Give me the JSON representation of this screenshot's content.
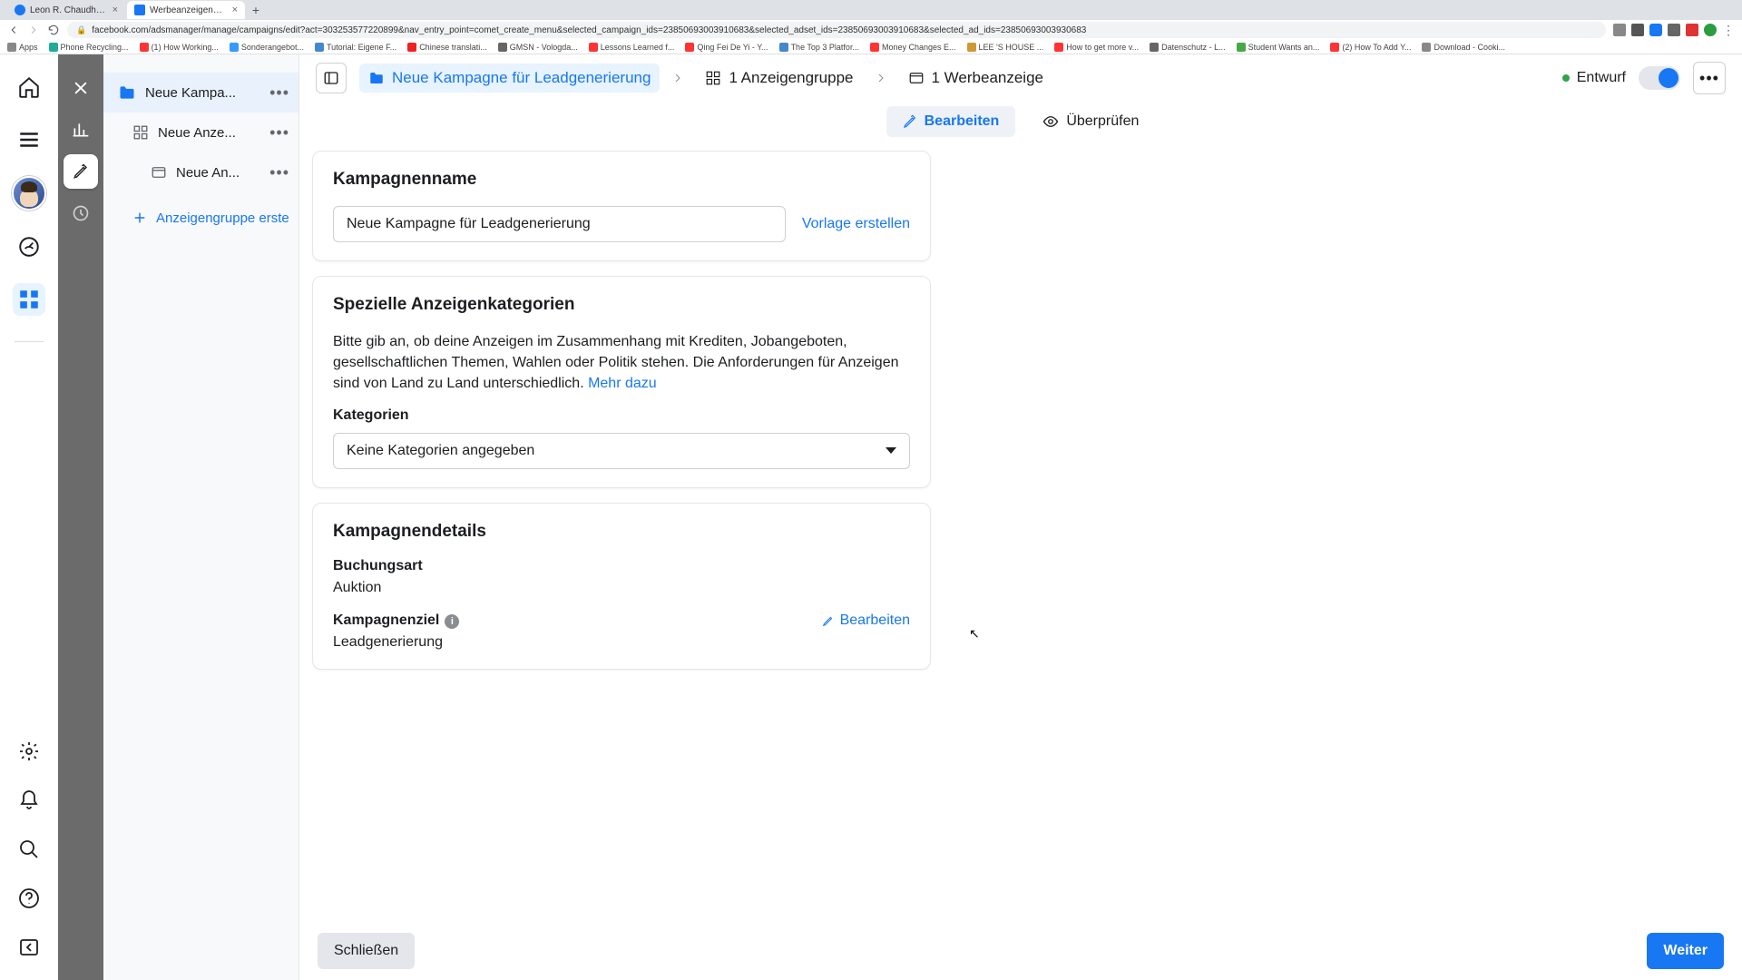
{
  "browser": {
    "tabs": [
      {
        "title": "Leon R. Chaudhari | Facebook"
      },
      {
        "title": "Werbeanzeigenmanager - We"
      }
    ],
    "url": "facebook.com/adsmanager/manage/campaigns/edit?act=303253577220899&nav_entry_point=comet_create_menu&selected_campaign_ids=23850693003910683&selected_adset_ids=23850693003910683&selected_ad_ids=23850693003930683",
    "bookmarks": [
      "Apps",
      "Phone Recycling...",
      "(1) How Working...",
      "Sonderangebot...",
      "Tutorial: Eigene F...",
      "Chinese translati...",
      "GMSN - Vologda...",
      "Lessons Learned f...",
      "Qing Fei De Yi - Y...",
      "The Top 3 Platfor...",
      "Money Changes E...",
      "LEE 'S HOUSE ...",
      "How to get more v...",
      "Datenschutz - L...",
      "Student Wants an...",
      "(2) How To Add Y...",
      "Download - Cooki..."
    ]
  },
  "tree": {
    "campaign": "Neue Kampa...",
    "adset": "Neue Anze...",
    "ad": "Neue An...",
    "add": "Anzeigengruppe erste"
  },
  "crumbs": {
    "campaign": "Neue Kampagne für Leadgenerierung",
    "adset": "1 Anzeigengruppe",
    "ad": "1 Werbeanzeige",
    "status": "Entwurf"
  },
  "subtabs": {
    "edit": "Bearbeiten",
    "review": "Überprüfen"
  },
  "section_name": {
    "title": "Kampagnenname",
    "value": "Neue Kampagne für Leadgenerierung",
    "template_link": "Vorlage erstellen"
  },
  "section_categories": {
    "title": "Spezielle Anzeigenkategorien",
    "desc": "Bitte gib an, ob deine Anzeigen im Zusammenhang mit Krediten, Jobangeboten, gesellschaftlichen Themen, Wahlen oder Politik stehen. Die Anforderungen für Anzeigen sind von Land zu Land unterschiedlich. ",
    "more": "Mehr dazu",
    "field_label": "Kategorien",
    "select_value": "Keine Kategorien angegeben"
  },
  "section_details": {
    "title": "Kampagnendetails",
    "booking_label": "Buchungsart",
    "booking_value": "Auktion",
    "objective_label": "Kampagnenziel",
    "objective_value": "Leadgenerierung",
    "edit": "Bearbeiten"
  },
  "footer": {
    "close": "Schließen",
    "next": "Weiter"
  }
}
